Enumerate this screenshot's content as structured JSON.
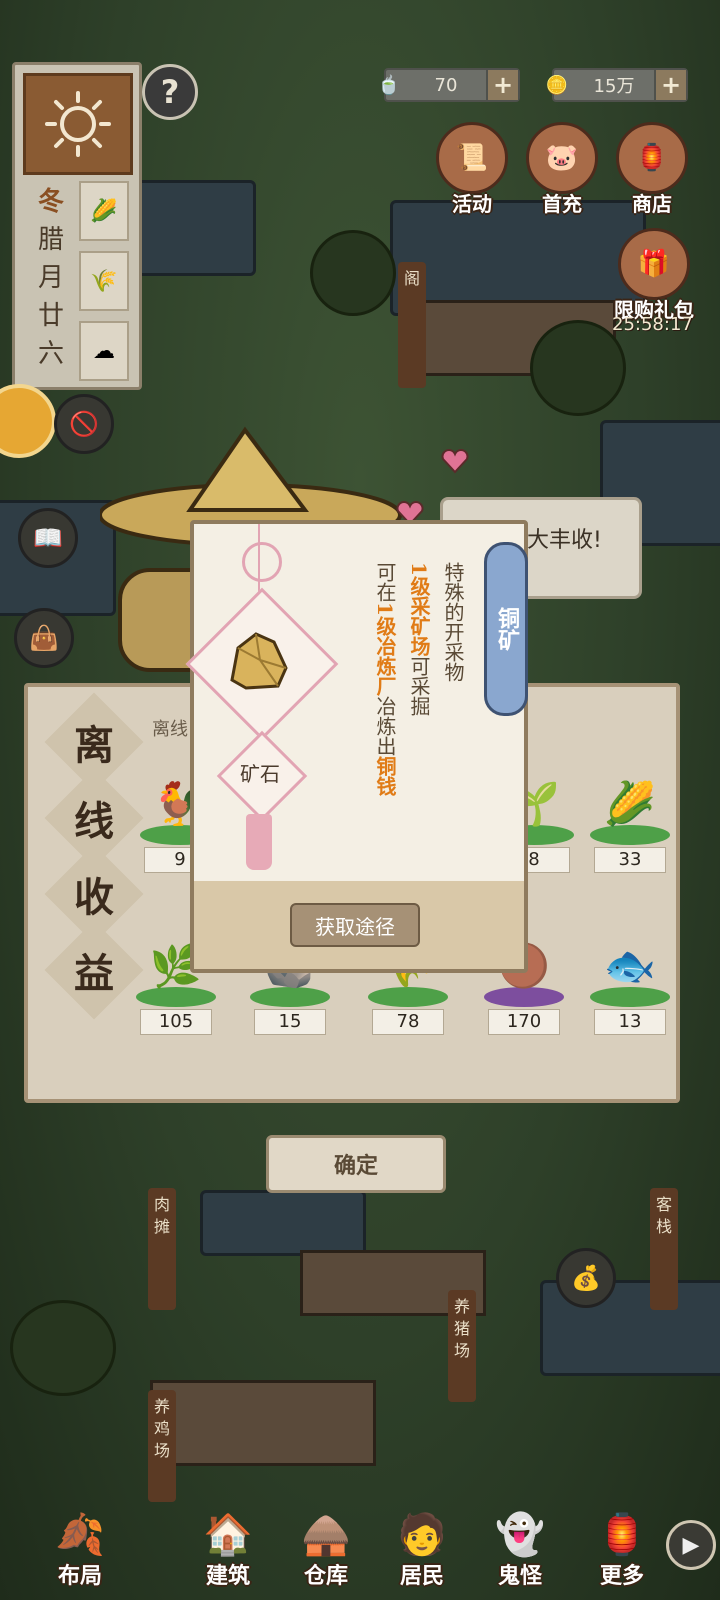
{
  "season": {
    "season_char": "冬",
    "date_chars": [
      "腊",
      "月",
      "廿",
      "六"
    ]
  },
  "currencies": [
    {
      "icon": "tea-cup-icon",
      "value": "70"
    },
    {
      "icon": "copper-coin-icon",
      "value": "15万"
    }
  ],
  "top_buttons": [
    {
      "label": "活动",
      "icon": "scroll-icon"
    },
    {
      "label": "首充",
      "icon": "pig-icon"
    },
    {
      "label": "商店",
      "icon": "ingot-icon"
    }
  ],
  "limited_pack": {
    "label": "限购礼包",
    "timer": "25:58:17"
  },
  "signs": {
    "pavilion": "阁",
    "butcher": "肉摊",
    "inn": "客栈",
    "pig_farm": "养猪场",
    "chicken_farm": "养鸡场"
  },
  "speech_bubble": "大丰收!",
  "offline": {
    "title": [
      "离",
      "线",
      "收",
      "益"
    ],
    "subtitle": "离线",
    "row1": [
      {
        "icon": "chicken-icon",
        "count": "9",
        "plate": "green"
      },
      {
        "icon": "grass-sprout-icon",
        "count": "8",
        "plate": "green"
      },
      {
        "icon": "corn-icon",
        "count": "33",
        "plate": "green"
      }
    ],
    "row2": [
      {
        "icon": "scallion-icon",
        "count": "105",
        "plate": "green"
      },
      {
        "icon": "ore-rock-icon",
        "count": "15",
        "plate": "green"
      },
      {
        "icon": "wheat-icon",
        "count": "78",
        "plate": "green"
      },
      {
        "icon": "manure-icon",
        "count": "170",
        "plate": "purple"
      },
      {
        "icon": "fish-icon",
        "count": "13",
        "plate": "green"
      }
    ],
    "confirm_label": "确定"
  },
  "popup": {
    "item_name": "铜矿",
    "item_type": "矿石",
    "description": {
      "line1": "特殊的开采物",
      "line2_hl": "1级采矿场",
      "line2": "可采掘",
      "line3a": "可在",
      "line3_hl": "1级冶炼厂",
      "line3b": "冶炼出",
      "line3_hl2": "铜钱"
    },
    "acquire_label": "获取途径"
  },
  "nav": [
    {
      "label": "布局",
      "icon": "layout-icon"
    },
    {
      "label": "建筑",
      "icon": "building-icon"
    },
    {
      "label": "仓库",
      "icon": "warehouse-icon"
    },
    {
      "label": "居民",
      "icon": "resident-icon"
    },
    {
      "label": "鬼怪",
      "icon": "ghost-icon"
    },
    {
      "label": "更多",
      "icon": "lantern-icon"
    }
  ],
  "colors": {
    "highlight": "#e07b16",
    "name_tab": "#8aa7cf",
    "pendant": "#e2a4b3"
  }
}
